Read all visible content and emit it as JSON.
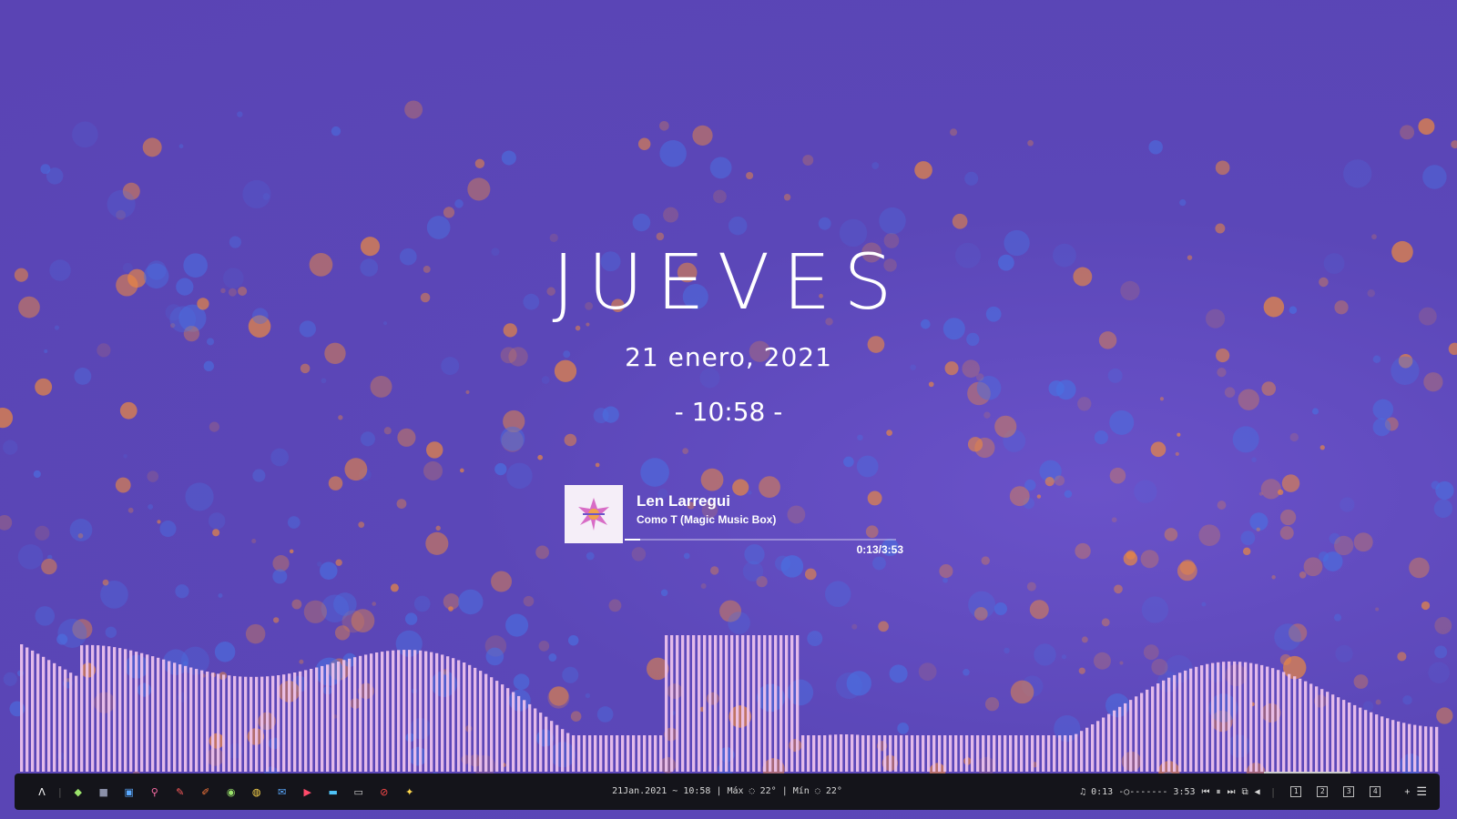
{
  "desktop": {
    "day": "JUEVES",
    "date": "21 enero, 2021",
    "time": "- 10:58 -"
  },
  "player": {
    "artist": "Len Larregui",
    "track": "Como T (Magic Music Box)",
    "time": "0:13/3:53",
    "progress": 0.056
  },
  "taskbar": {
    "launcher_icons": [
      {
        "name": "arch-icon",
        "glyph": "Λ",
        "color": "#ffffff"
      },
      {
        "name": "tag-icon",
        "glyph": "◆",
        "color": "#9be36b"
      },
      {
        "name": "camera-icon",
        "glyph": "■",
        "color": "#8a8fa8"
      },
      {
        "name": "calendar-icon",
        "glyph": "▣",
        "color": "#5aa9ff"
      },
      {
        "name": "search-icon",
        "glyph": "⚲",
        "color": "#ff6fa9"
      },
      {
        "name": "brush-icon",
        "glyph": "✎",
        "color": "#ff5c5c"
      },
      {
        "name": "edit-icon",
        "glyph": "✐",
        "color": "#ff7a3d"
      },
      {
        "name": "github-icon",
        "glyph": "◉",
        "color": "#9be36b"
      },
      {
        "name": "reddit-icon",
        "glyph": "◍",
        "color": "#ffd84d"
      },
      {
        "name": "mail-icon",
        "glyph": "✉",
        "color": "#5aa9ff"
      },
      {
        "name": "youtube-icon",
        "glyph": "▶",
        "color": "#ff4a6a"
      },
      {
        "name": "folder-icon",
        "glyph": "▬",
        "color": "#4fc3f7"
      },
      {
        "name": "window-icon",
        "glyph": "▭",
        "color": "#cfcfcf"
      },
      {
        "name": "block-icon",
        "glyph": "⊘",
        "color": "#ff4a4a"
      },
      {
        "name": "pin-icon",
        "glyph": "✦",
        "color": "#ffd84d"
      }
    ],
    "status": "21Jan.2021 ~ 10:58 | Máx ◌ 22° | Mín ◌ 22°",
    "music_status": "♫ 0:13 -○------- 3:53",
    "controls": [
      "⏮",
      "⏸",
      "⏭",
      "⧉",
      "◀"
    ],
    "workspaces": [
      "1",
      "2",
      "3",
      "4"
    ],
    "extra": [
      "+",
      "☰"
    ]
  },
  "colors": {
    "accent": "#ffffff",
    "bg": "#5a44b4",
    "visualizer": "#f2c6f0",
    "bokeh_orange": "#f08a3c",
    "bokeh_blue": "#4a6fe0"
  }
}
